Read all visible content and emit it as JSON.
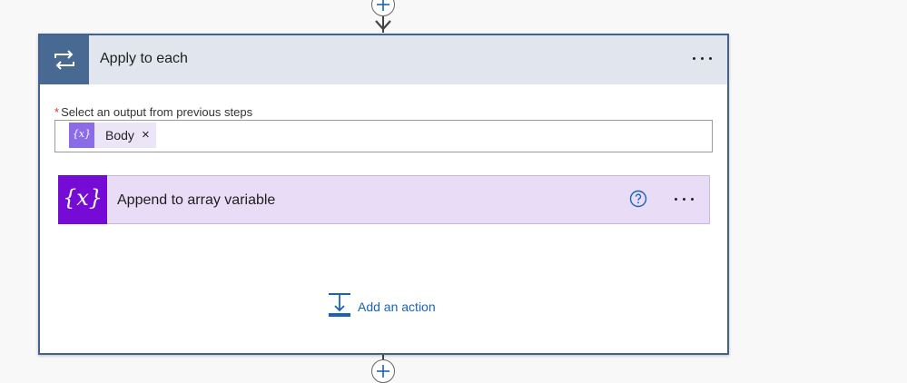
{
  "loop": {
    "title": "Apply to each",
    "icon": "loop-icon",
    "header_color": "#486991",
    "border_color": "#43628f",
    "more_icon": "more-options-icon"
  },
  "field": {
    "required_marker": "*",
    "label": "Select an output from previous steps",
    "token": {
      "icon": "expression-icon",
      "icon_glyph": "{x}",
      "label": "Body",
      "remove_glyph": "×"
    }
  },
  "action": {
    "title": "Append to array variable",
    "icon": "variable-icon",
    "icon_glyph": "{x}",
    "color": "#770bd6",
    "help_icon": "help-icon",
    "more_icon": "more-options-icon"
  },
  "add_action": {
    "label": "Add an action",
    "icon": "add-action-icon",
    "color": "#1a62b8"
  },
  "connectors": {
    "top_plus_icon": "insert-step-icon",
    "bottom_plus_icon": "insert-step-icon"
  }
}
